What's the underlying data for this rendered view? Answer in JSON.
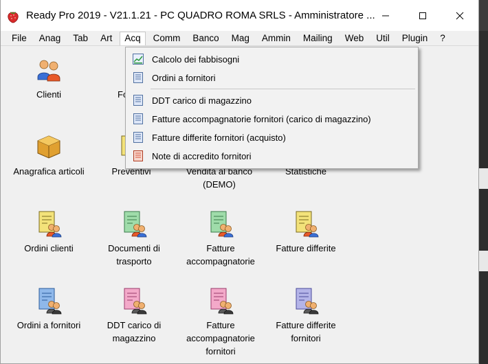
{
  "window": {
    "title": "Ready Pro 2019 - V21.1.21 - PC QUADRO ROMA SRLS - Amministratore ...",
    "controls": [
      "minimize-icon",
      "maximize-icon",
      "close-icon"
    ]
  },
  "menubar": {
    "items": [
      "File",
      "Anag",
      "Tab",
      "Art",
      "Acq",
      "Comm",
      "Banco",
      "Mag",
      "Ammin",
      "Mailing",
      "Web",
      "Util",
      "Plugin",
      "?"
    ],
    "active": "Acq"
  },
  "dropdown": {
    "items": [
      {
        "label": "Calcolo dei fabbisogni",
        "icon": "chart-icon"
      },
      {
        "label": "Ordini a fornitori",
        "icon": "document-icon"
      },
      {
        "label": "DDT carico di magazzino",
        "icon": "document-icon"
      },
      {
        "label": "Fatture accompagnatorie fornitori (carico di magazzino)",
        "icon": "document-icon"
      },
      {
        "label": "Fatture differite fornitori (acquisto)",
        "icon": "document-icon"
      },
      {
        "label": "Note di accredito fornitori",
        "icon": "red-document-icon"
      }
    ]
  },
  "desktop": {
    "icons": [
      {
        "label": "Clienti",
        "icon": "users-icon"
      },
      {
        "label": "Fo",
        "icon": "users-icon"
      },
      {
        "label": "Anagrafica articoli",
        "icon": "box-icon"
      },
      {
        "label": "Preventivi",
        "icon": "document-user-icon"
      },
      {
        "label": "Vendita al banco (DEMO)",
        "icon": "register-icon"
      },
      {
        "label": "Statistiche",
        "icon": "chart-icon"
      },
      {
        "label": "Ordini clienti",
        "icon": "document-user-icon"
      },
      {
        "label": "Documenti di trasporto",
        "icon": "document-user-icon"
      },
      {
        "label": "Fatture accompagnatorie",
        "icon": "document-user-icon"
      },
      {
        "label": "Fatture differite",
        "icon": "document-user-icon"
      },
      {
        "label": "Ordini a fornitori",
        "icon": "document-user-icon"
      },
      {
        "label": "DDT carico di magazzino",
        "icon": "document-user-icon"
      },
      {
        "label": "Fatture accompagnatorie fornitori",
        "icon": "document-user-icon"
      },
      {
        "label": "Fatture differite fornitori",
        "icon": "document-user-icon"
      }
    ]
  },
  "colors": {
    "doc_yellow": "#f3e27a",
    "doc_green": "#9fdcaa",
    "doc_blue": "#8fb8ea",
    "doc_pink": "#f3a9c9",
    "doc_lavender": "#b4b4e8",
    "menu_red": "#d8533a"
  }
}
